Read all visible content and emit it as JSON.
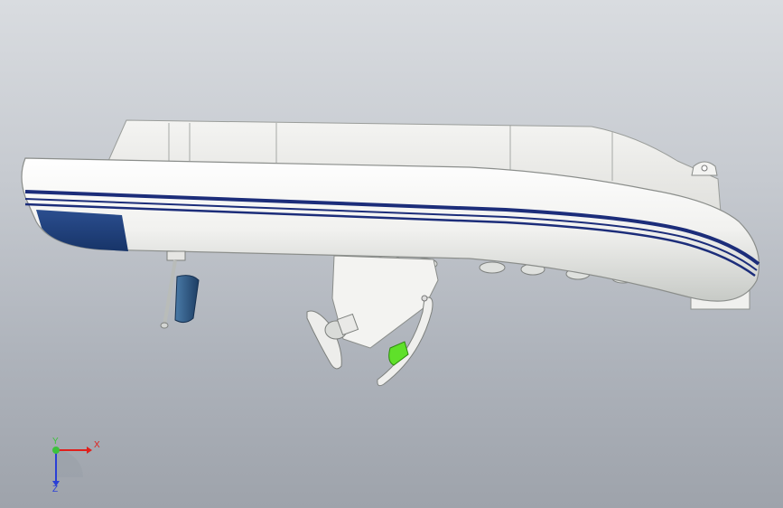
{
  "triad": {
    "x_label": "X",
    "y_label": "Y",
    "z_label": "Z",
    "x_color": "#e0201c",
    "y_color": "#3cc23c",
    "z_color": "#2a3fd6"
  },
  "model": {
    "hull_color": "#f2f2f0",
    "stripe_color": "#1c2d7a",
    "bow_patch_color": "#1f3f7a",
    "tube_shadow_color": "#c9ccc9",
    "highlight_color": "#5fe02a"
  }
}
